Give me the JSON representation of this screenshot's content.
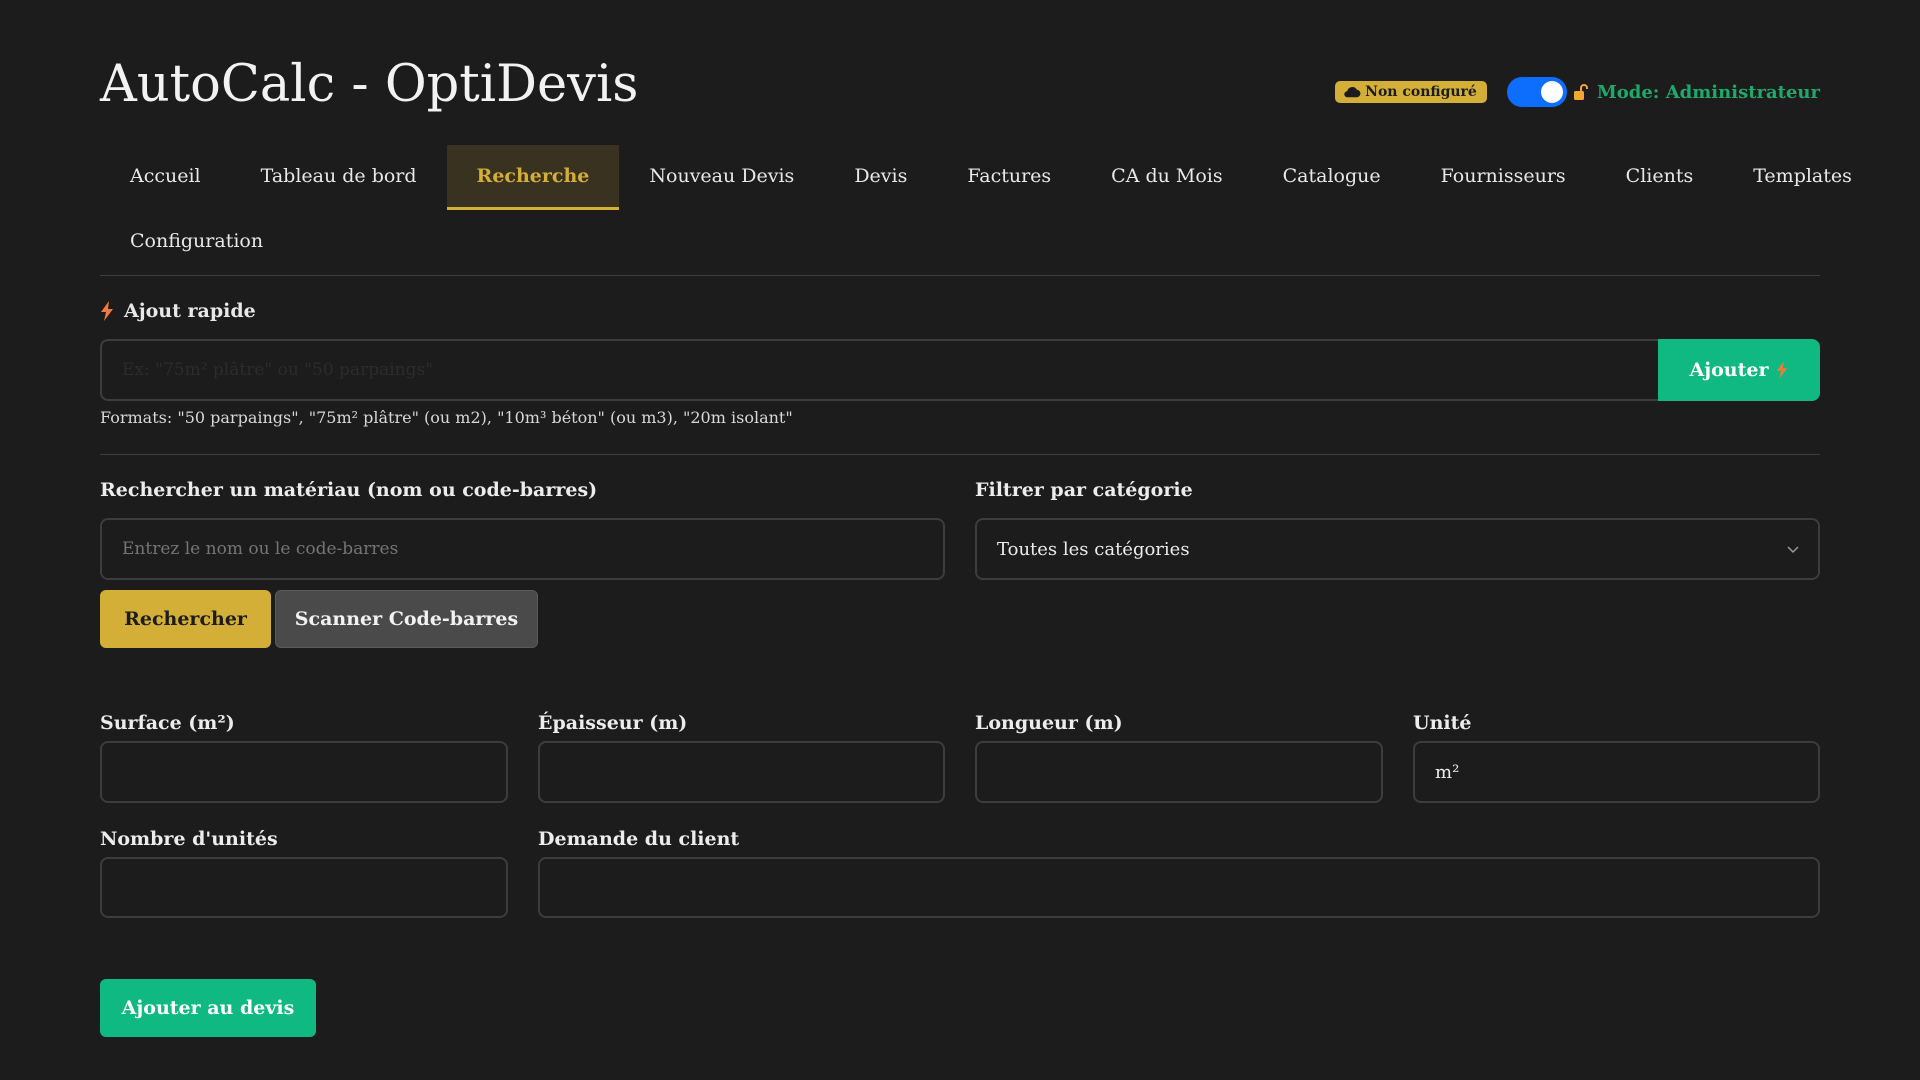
{
  "app": {
    "title": "AutoCalc - OptiDevis",
    "cloud_status": "Non configuré",
    "mode_label": "Mode: Administrateur",
    "admin_toggle_on": true
  },
  "nav": {
    "items": [
      {
        "label": "Accueil",
        "active": false
      },
      {
        "label": "Tableau de bord",
        "active": false
      },
      {
        "label": "Recherche",
        "active": true
      },
      {
        "label": "Nouveau Devis",
        "active": false
      },
      {
        "label": "Devis",
        "active": false
      },
      {
        "label": "Factures",
        "active": false
      },
      {
        "label": "CA du Mois",
        "active": false
      },
      {
        "label": "Catalogue",
        "active": false
      },
      {
        "label": "Fournisseurs",
        "active": false
      },
      {
        "label": "Clients",
        "active": false
      },
      {
        "label": "Templates",
        "active": false
      },
      {
        "label": "Configuration",
        "active": false
      }
    ]
  },
  "quick_add": {
    "title": "Ajout rapide",
    "placeholder": "Ex: \"75m² plâtre\" ou \"50 parpaings\"",
    "button_label": "Ajouter",
    "help": "Formats: \"50 parpaings\", \"75m² plâtre\" (ou m2), \"10m³ béton\" (ou m3), \"20m isolant\""
  },
  "search": {
    "label": "Rechercher un matériau (nom ou code-barres)",
    "placeholder": "Entrez le nom ou le code-barres",
    "category_label": "Filtrer par catégorie",
    "category_selected": "Toutes les catégories",
    "search_button": "Rechercher",
    "scan_button": "Scanner Code-barres"
  },
  "fields": {
    "surface_label": "Surface (m²)",
    "surface_value": "",
    "epaisseur_label": "Épaisseur (m)",
    "epaisseur_value": "",
    "longueur_label": "Longueur (m)",
    "longueur_value": "",
    "unite_label": "Unité",
    "unite_value": "m²",
    "nombre_label": "Nombre d'unités",
    "nombre_value": "",
    "demande_label": "Demande du client",
    "demande_value": ""
  },
  "actions": {
    "add_to_quote": "Ajouter au devis"
  },
  "colors": {
    "background": "#1c1c1c",
    "accent_gold": "#d4af37",
    "accent_green": "#10b981",
    "toggle_blue": "#0d6efd"
  }
}
